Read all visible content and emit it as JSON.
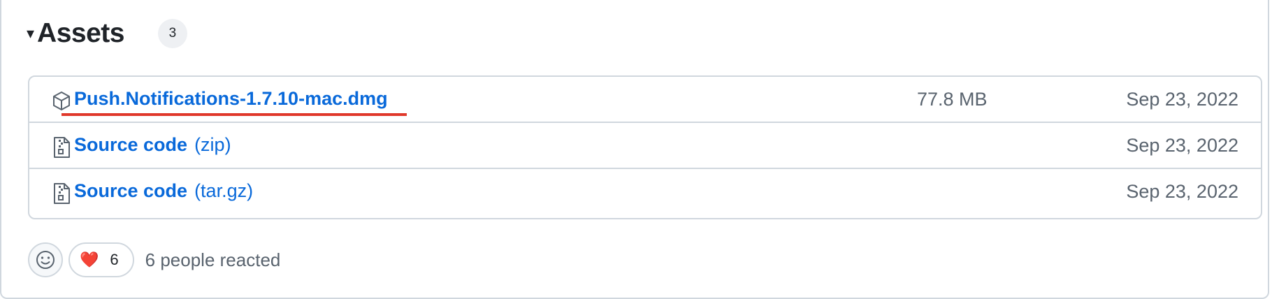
{
  "assets": {
    "title": "Assets",
    "count": "3",
    "caret": "▾"
  },
  "files": [
    {
      "name": "Push.Notifications-1.7.10-mac.dmg",
      "ext": "",
      "size": "77.8 MB",
      "date": "Sep 23, 2022",
      "icon": "package-icon"
    },
    {
      "name": "Source code",
      "ext": "(zip)",
      "size": "",
      "date": "Sep 23, 2022",
      "icon": "file-zip-icon"
    },
    {
      "name": "Source code",
      "ext": "(tar.gz)",
      "size": "",
      "date": "Sep 23, 2022",
      "icon": "file-zip-icon"
    }
  ],
  "reactions": {
    "heart_emoji": "❤️",
    "heart_count": "6",
    "summary": "6 people reacted"
  },
  "colors": {
    "link": "#0969da",
    "muted": "#59636e",
    "border": "#d0d7de",
    "annotation": "#e0382b"
  }
}
